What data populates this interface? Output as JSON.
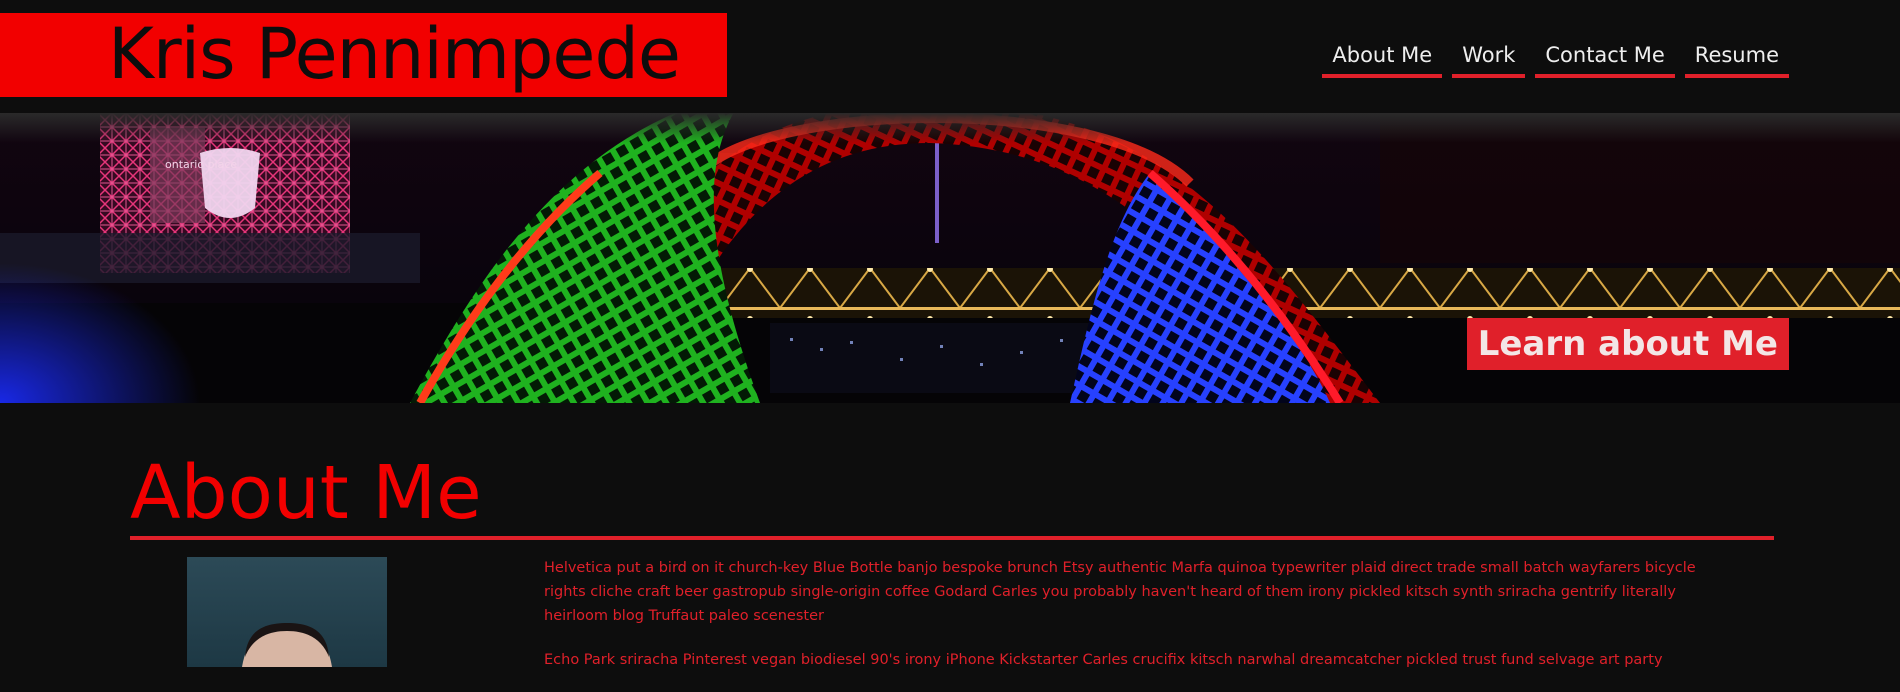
{
  "header": {
    "site_title": "Kris Pennimpede",
    "nav": [
      {
        "label": "About Me"
      },
      {
        "label": "Work"
      },
      {
        "label": "Contact Me"
      },
      {
        "label": "Resume"
      }
    ]
  },
  "hero": {
    "cta_label": "Learn about Me",
    "sign_text": "ontario place"
  },
  "about": {
    "heading": "About Me",
    "paragraphs": [
      "Helvetica put a bird on it church-key Blue Bottle banjo bespoke brunch Etsy authentic Marfa quinoa typewriter plaid direct trade small batch wayfarers bicycle rights cliche craft beer gastropub single-origin coffee Godard Carles you probably haven't heard of them irony pickled kitsch synth sriracha gentrify literally heirloom blog Truffaut paleo scenester",
      "Echo Park sriracha Pinterest vegan biodiesel 90's irony iPhone Kickstarter Carles crucifix kitsch narwhal dreamcatcher pickled trust fund selvage art party"
    ]
  },
  "colors": {
    "background": "#0d0d0d",
    "accent_red": "#f20000",
    "underline_red": "#e0202a",
    "nav_text": "#eeeeee"
  },
  "icons": {
    "hero_image": "light-sculpture-night-photo",
    "portrait": "profile-photo"
  }
}
